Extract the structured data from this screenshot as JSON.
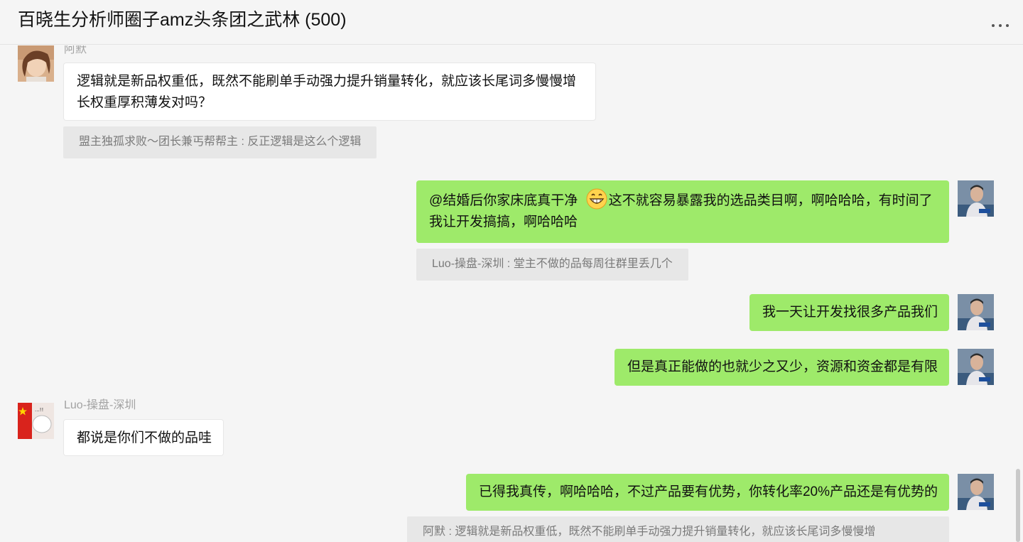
{
  "header": {
    "title": "百晓生分析师圈子amz头条团之武林 (500)",
    "more_icon": "more-horizontal-icon"
  },
  "messages": [
    {
      "direction": "in",
      "sender": "阿默",
      "text": "逻辑就是新品权重低，既然不能刷单手动强力提升销量转化，就应该长尾词多慢慢增长权重厚积薄发对吗？",
      "quote": "盟主独孤求败～团长兼丐帮帮主 : 反正逻辑是这么个逻辑"
    },
    {
      "direction": "out",
      "text_before_emoji": "@结婚后你家床底真干净 ",
      "emoji": "grinning-face-icon",
      "text_after_emoji": "这不就容易暴露我的选品类目啊，啊哈哈哈，有时间了我让开发搞搞，啊哈哈哈",
      "quote": "Luo-操盘-深圳 : 堂主不做的品每周往群里丢几个"
    },
    {
      "direction": "out",
      "text": "我一天让开发找很多产品我们"
    },
    {
      "direction": "out",
      "text": "但是真正能做的也就少之又少，资源和资金都是有限"
    },
    {
      "direction": "in",
      "sender": "Luo-操盘-深圳",
      "text": "都说是你们不做的品哇"
    },
    {
      "direction": "out",
      "text": "已得我真传，啊哈哈哈，不过产品要有优势，你转化率20%产品还是有优势的",
      "quote": "阿默 : 逻辑就是新品权重低，既然不能刷单手动强力提升销量转化，就应该长尾词多慢慢增"
    }
  ],
  "colors": {
    "background": "#f5f5f5",
    "incoming_bubble": "#ffffff",
    "outgoing_bubble": "#9eea6a",
    "quote_background": "#e7e7e7",
    "sender_name": "#a2a2a2"
  }
}
